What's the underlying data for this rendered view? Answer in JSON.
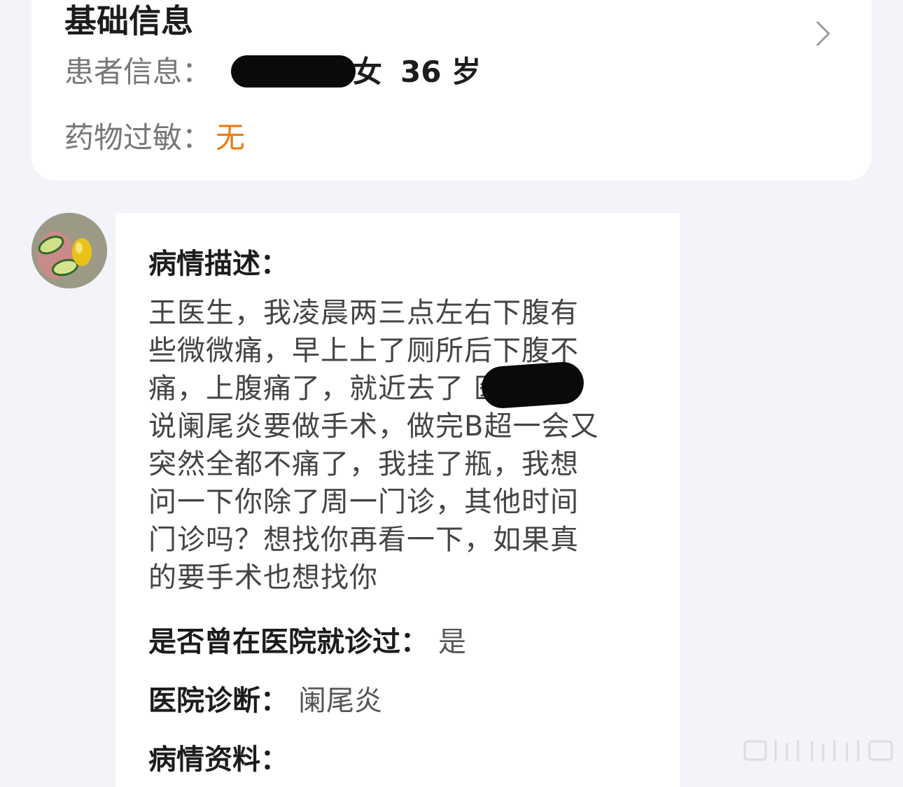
{
  "basic_info": {
    "title": "基础信息",
    "patient_label": "患者信息：",
    "gender": "女",
    "age": "36 岁",
    "allergy_label": "药物过敏：",
    "allergy_value": "无"
  },
  "message": {
    "description_label": "病情描述：",
    "description_text": "王医生，我凌晨两三点左右下腹有\n些微微痛，早上上了厕所后下腹不\n痛，上腹痛了，就近去了    医院\n说阑尾炎要做手术，做完B超一会又\n突然全都不痛了，我挂了瓶，我想\n问一下你除了周一门诊，其他时间\n门诊吗？想找你再看一下，如果真\n的要手术也想找你",
    "visited_label": "是否曾在医院就诊过：",
    "visited_value": "是",
    "diagnosis_label": "医院诊断：",
    "diagnosis_value": "阑尾炎",
    "materials_label": "病情资料："
  },
  "icons": {
    "chevron": "chevron-right-icon",
    "avatar": "fruit-avatar-image",
    "watermark": "watermark-logo"
  },
  "colors": {
    "accent_orange": "#ec7a12",
    "page_bg": "#f3f4f9"
  }
}
